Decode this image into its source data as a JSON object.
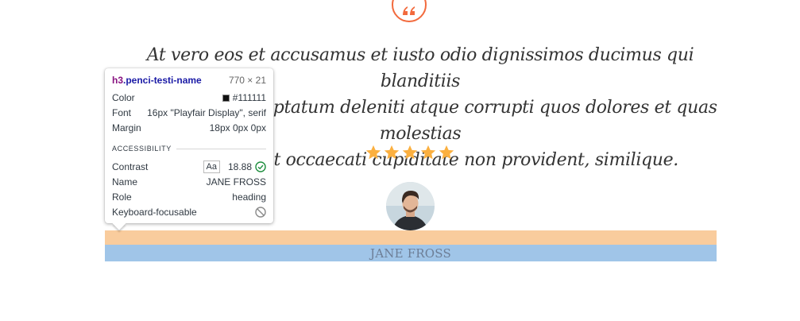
{
  "testimonial": {
    "quote_lines": [
      "At vero eos et accusamus et iusto odio dignissimos ducimus qui blanditiis",
      "praesentium voluptatum deleniti atque corrupti quos dolores et quas molestias",
      "excepturi sint occaecati cupiditate non provident, similique."
    ],
    "rating": 5,
    "rating_max": 5,
    "name": "JANE FROSS",
    "accent_color": "#f26a3d",
    "star_color": "#fbb040"
  },
  "inspector": {
    "tag": "h3",
    "class_name": ".penci-testi-name",
    "size": "770 × 21",
    "rows": [
      {
        "label": "Color",
        "value": "#111111"
      },
      {
        "label": "Font",
        "value": "16px \"Playfair Display\", serif"
      },
      {
        "label": "Margin",
        "value": "18px 0px 0px"
      }
    ],
    "section_title": "ACCESSIBILITY",
    "a11y_rows": [
      {
        "label": "Contrast",
        "badge": "Aa",
        "value": "18.88",
        "icon": "check-circle-icon"
      },
      {
        "label": "Name",
        "value": "JANE FROSS"
      },
      {
        "label": "Role",
        "value": "heading"
      },
      {
        "label": "Keyboard-focusable",
        "icon": "not-allowed-icon"
      }
    ],
    "colors": {
      "margin_overlay": "#f9cc9d",
      "content_overlay": "#a0c5e8",
      "check_green": "#1e8e3e"
    }
  }
}
